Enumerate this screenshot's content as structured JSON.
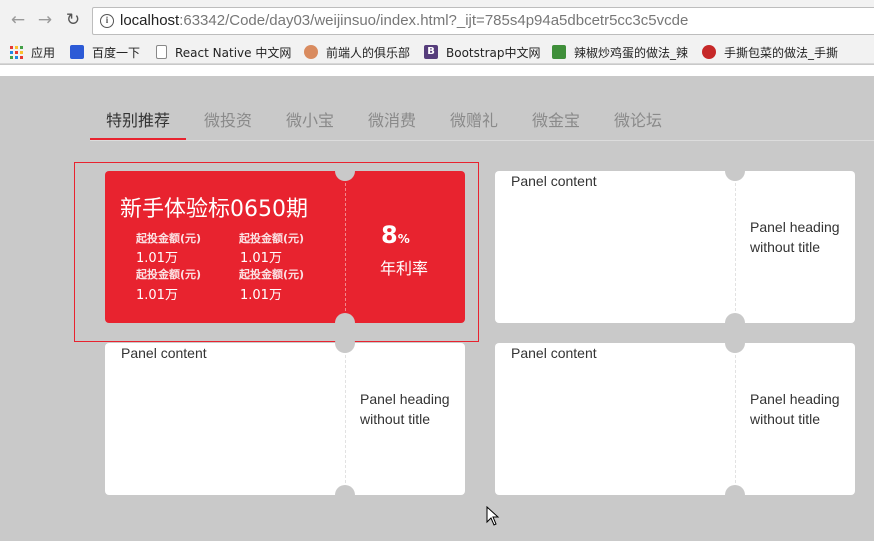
{
  "browser": {
    "url_host": "localhost",
    "url_path": ":63342/Code/day03/weijinsuo/index.html?_ijt=785s4p94a5dbcetr5cc3c5vcde",
    "icons": {
      "back": "arrow-left",
      "forward": "arrow-right",
      "reload": "reload",
      "info": "info"
    }
  },
  "bookmarks": [
    {
      "label": "应用",
      "icon": "apps-grid"
    },
    {
      "label": "百度一下",
      "icon": "baidu-paw"
    },
    {
      "label": "React Native 中文网",
      "icon": "page"
    },
    {
      "label": "前端人的俱乐部",
      "icon": "person"
    },
    {
      "label": "Bootstrap中文网",
      "icon": "bootstrap-b"
    },
    {
      "label": "辣椒炒鸡蛋的做法_辣",
      "icon": "recipe"
    },
    {
      "label": "手撕包菜的做法_手撕",
      "icon": "recipe-red"
    }
  ],
  "tabs": [
    {
      "label": "特别推荐",
      "active": true
    },
    {
      "label": "微投资"
    },
    {
      "label": "微小宝"
    },
    {
      "label": "微消费"
    },
    {
      "label": "微赠礼"
    },
    {
      "label": "微金宝"
    },
    {
      "label": "微论坛"
    }
  ],
  "featured_card": {
    "title": "新手体验标0650期",
    "fields": [
      {
        "label": "起投金额(元)",
        "value": "1.01万"
      },
      {
        "label": "起投金额(元)",
        "value": "1.01万"
      },
      {
        "label": "起投金额(元)",
        "value": "1.01万"
      },
      {
        "label": "起投金额(元)",
        "value": "1.01万"
      }
    ],
    "rate_value": "8",
    "rate_unit": "%",
    "rate_label": "年利率"
  },
  "panels": [
    {
      "content": "Panel content",
      "heading": "Panel heading without title"
    },
    {
      "content": "Panel content",
      "heading": "Panel heading without title"
    },
    {
      "content": "Panel content",
      "heading": "Panel heading without title"
    }
  ],
  "colors": {
    "accent": "#e8232f",
    "page_bg": "#c9c9c9"
  }
}
